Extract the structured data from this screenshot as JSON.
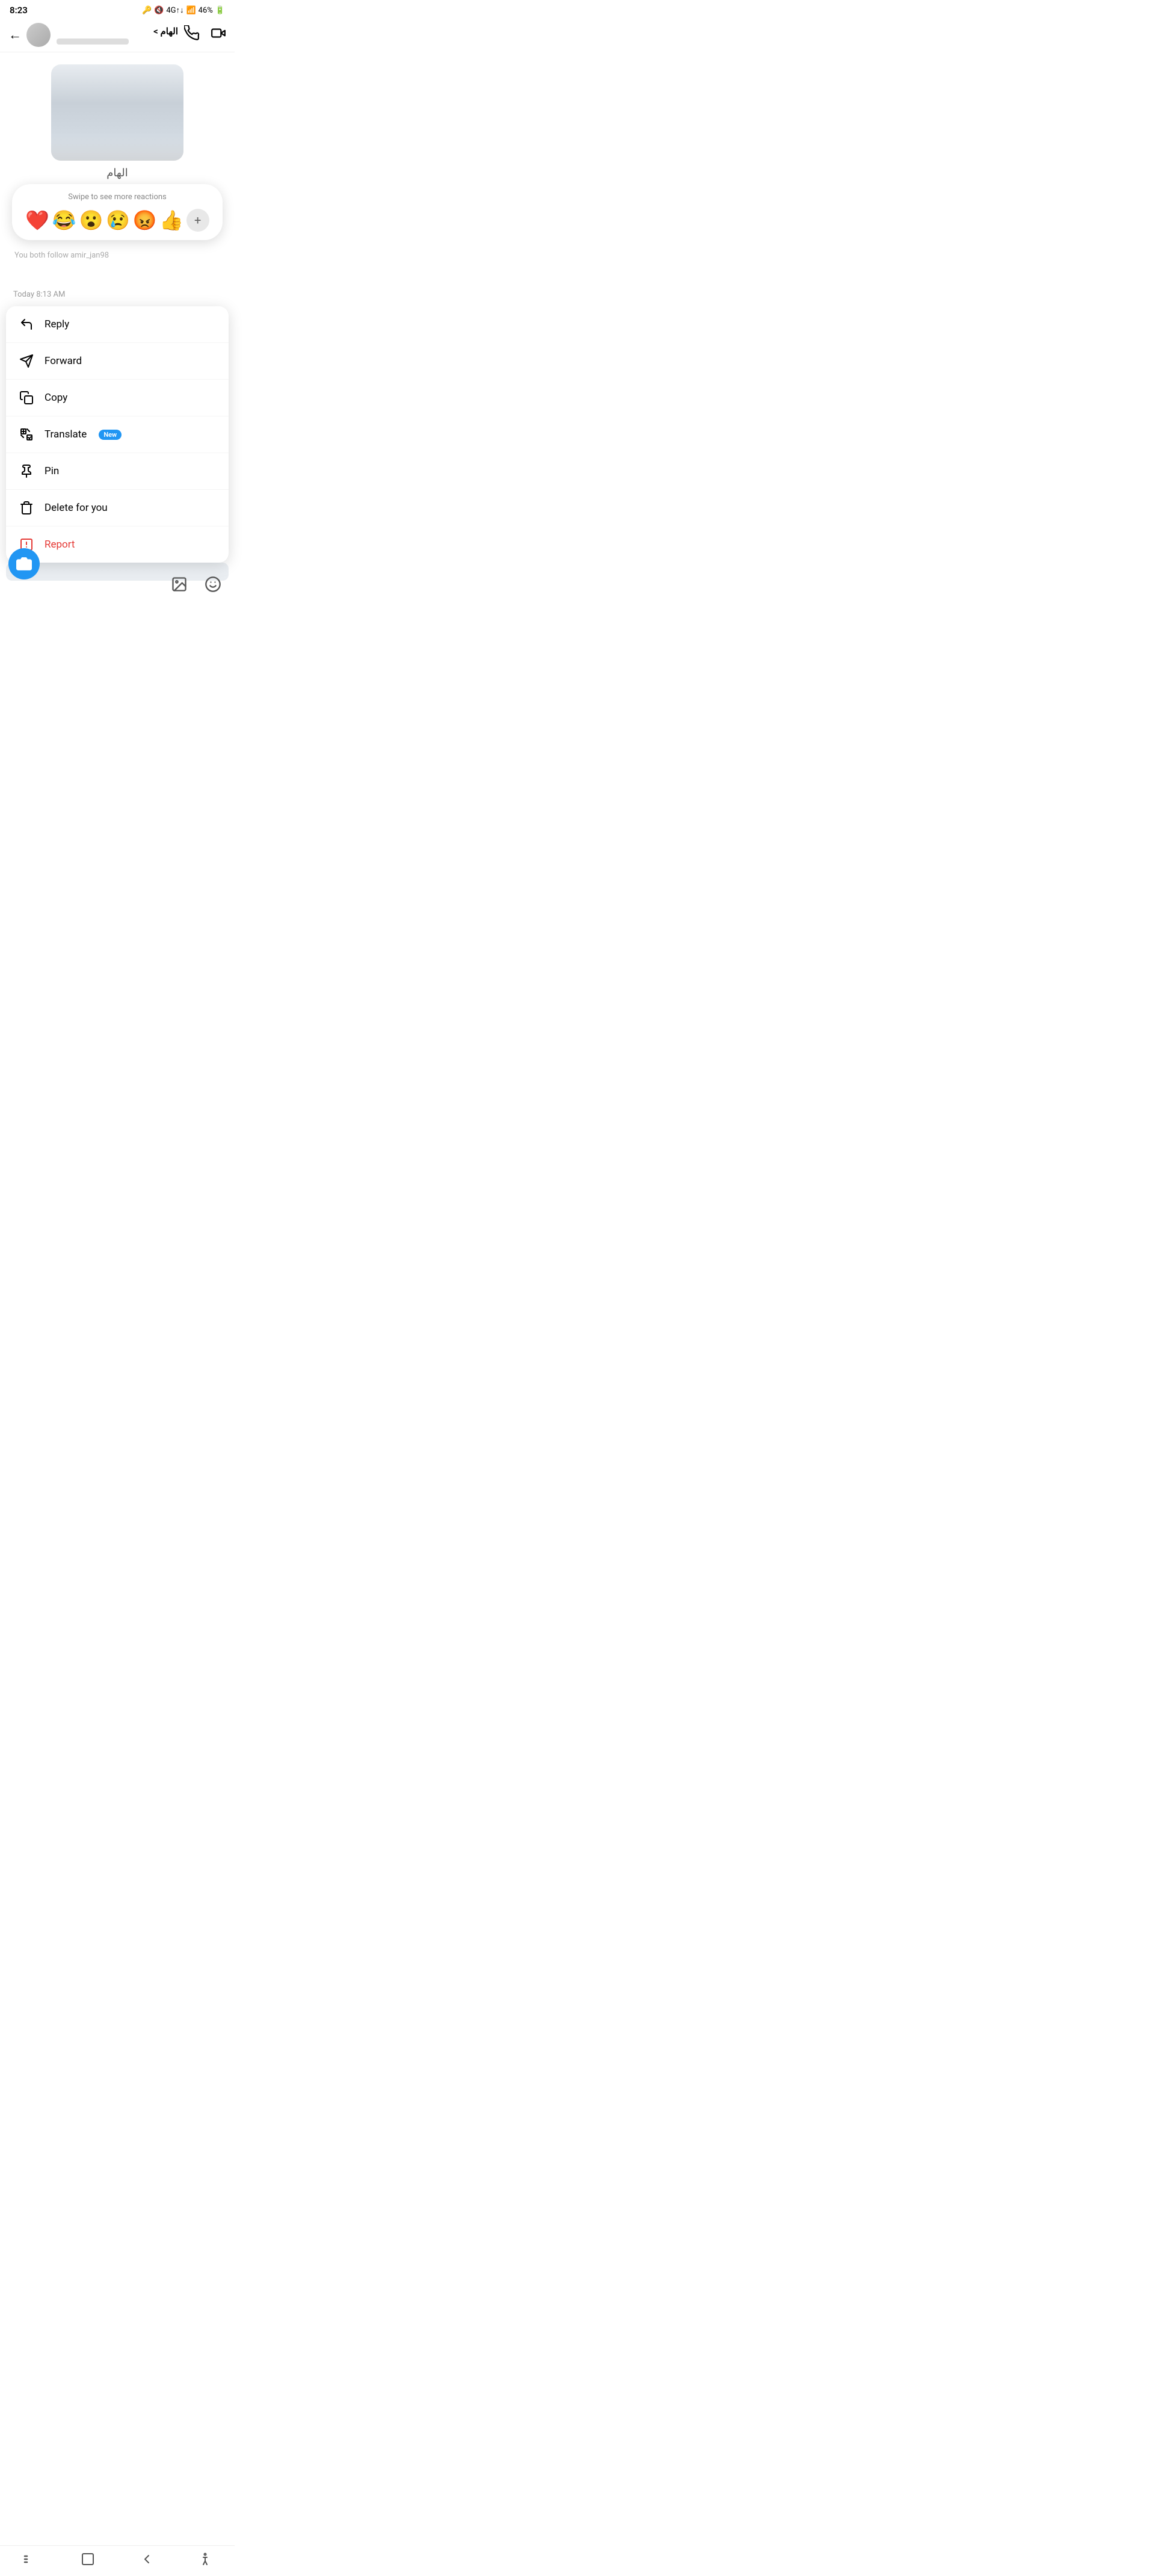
{
  "statusBar": {
    "time": "8:23",
    "batteryPercent": "46%",
    "signal": "4G"
  },
  "header": {
    "backLabel": "←",
    "contactName": "الهام >",
    "phoneIcon": "phone",
    "videoIcon": "video"
  },
  "chat": {
    "importantLabel": "الهام",
    "followText": "You both follow amir_jan98",
    "timestamp": "Today 8:13 AM"
  },
  "reactions": {
    "hint": "Swipe to see more reactions",
    "emojis": [
      "❤️",
      "😂",
      "😮",
      "😢",
      "😡",
      "👍"
    ],
    "addLabel": "+"
  },
  "contextMenu": {
    "items": [
      {
        "id": "reply",
        "label": "Reply",
        "icon": "reply"
      },
      {
        "id": "forward",
        "label": "Forward",
        "icon": "forward"
      },
      {
        "id": "copy",
        "label": "Copy",
        "icon": "copy"
      },
      {
        "id": "translate",
        "label": "Translate",
        "badge": "New",
        "icon": "translate"
      },
      {
        "id": "pin",
        "label": "Pin",
        "icon": "pin"
      },
      {
        "id": "delete",
        "label": "Delete for you",
        "icon": "delete"
      },
      {
        "id": "report",
        "label": "Report",
        "icon": "report",
        "red": true
      }
    ]
  },
  "bottomBar": {
    "galleryIcon": "gallery",
    "stickerIcon": "sticker"
  },
  "navBar": {
    "menuIcon": "|||",
    "homeIcon": "□",
    "backIcon": "<",
    "accessibilityIcon": "♿"
  }
}
